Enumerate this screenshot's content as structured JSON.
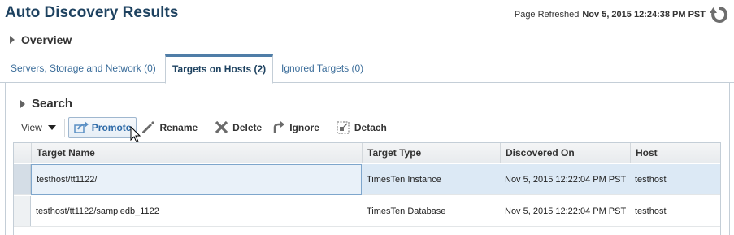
{
  "page": {
    "title": "Auto Discovery Results",
    "refresh_label": "Page Refreshed",
    "refresh_time": "Nov 5, 2015 12:24:38 PM PST"
  },
  "overview": {
    "label": "Overview"
  },
  "tabs": [
    {
      "label": "Servers, Storage and Network (0)",
      "active": false
    },
    {
      "label": "Targets on Hosts (2)",
      "active": true
    },
    {
      "label": "Ignored Targets (0)",
      "active": false
    }
  ],
  "search": {
    "label": "Search"
  },
  "toolbar": {
    "view": "View",
    "promote": "Promote",
    "rename": "Rename",
    "delete": "Delete",
    "ignore": "Ignore",
    "detach": "Detach"
  },
  "table": {
    "columns": [
      "Target Name",
      "Target Type",
      "Discovered On",
      "Host"
    ],
    "rows": [
      {
        "target_name": "testhost/tt1122/",
        "target_type": "TimesTen Instance",
        "discovered_on": "Nov 5, 2015 12:22:04 PM PST",
        "host": "testhost",
        "selected": true
      },
      {
        "target_name": "testhost/tt1122/sampledb_1122",
        "target_type": "TimesTen Database",
        "discovered_on": "Nov 5, 2015 12:22:04 PM PST",
        "host": "testhost",
        "selected": false
      }
    ]
  },
  "colors": {
    "title": "#1e4260",
    "link": "#3b6d9a",
    "selected_row": "#dce9f5",
    "accent": "#4f7da7"
  }
}
